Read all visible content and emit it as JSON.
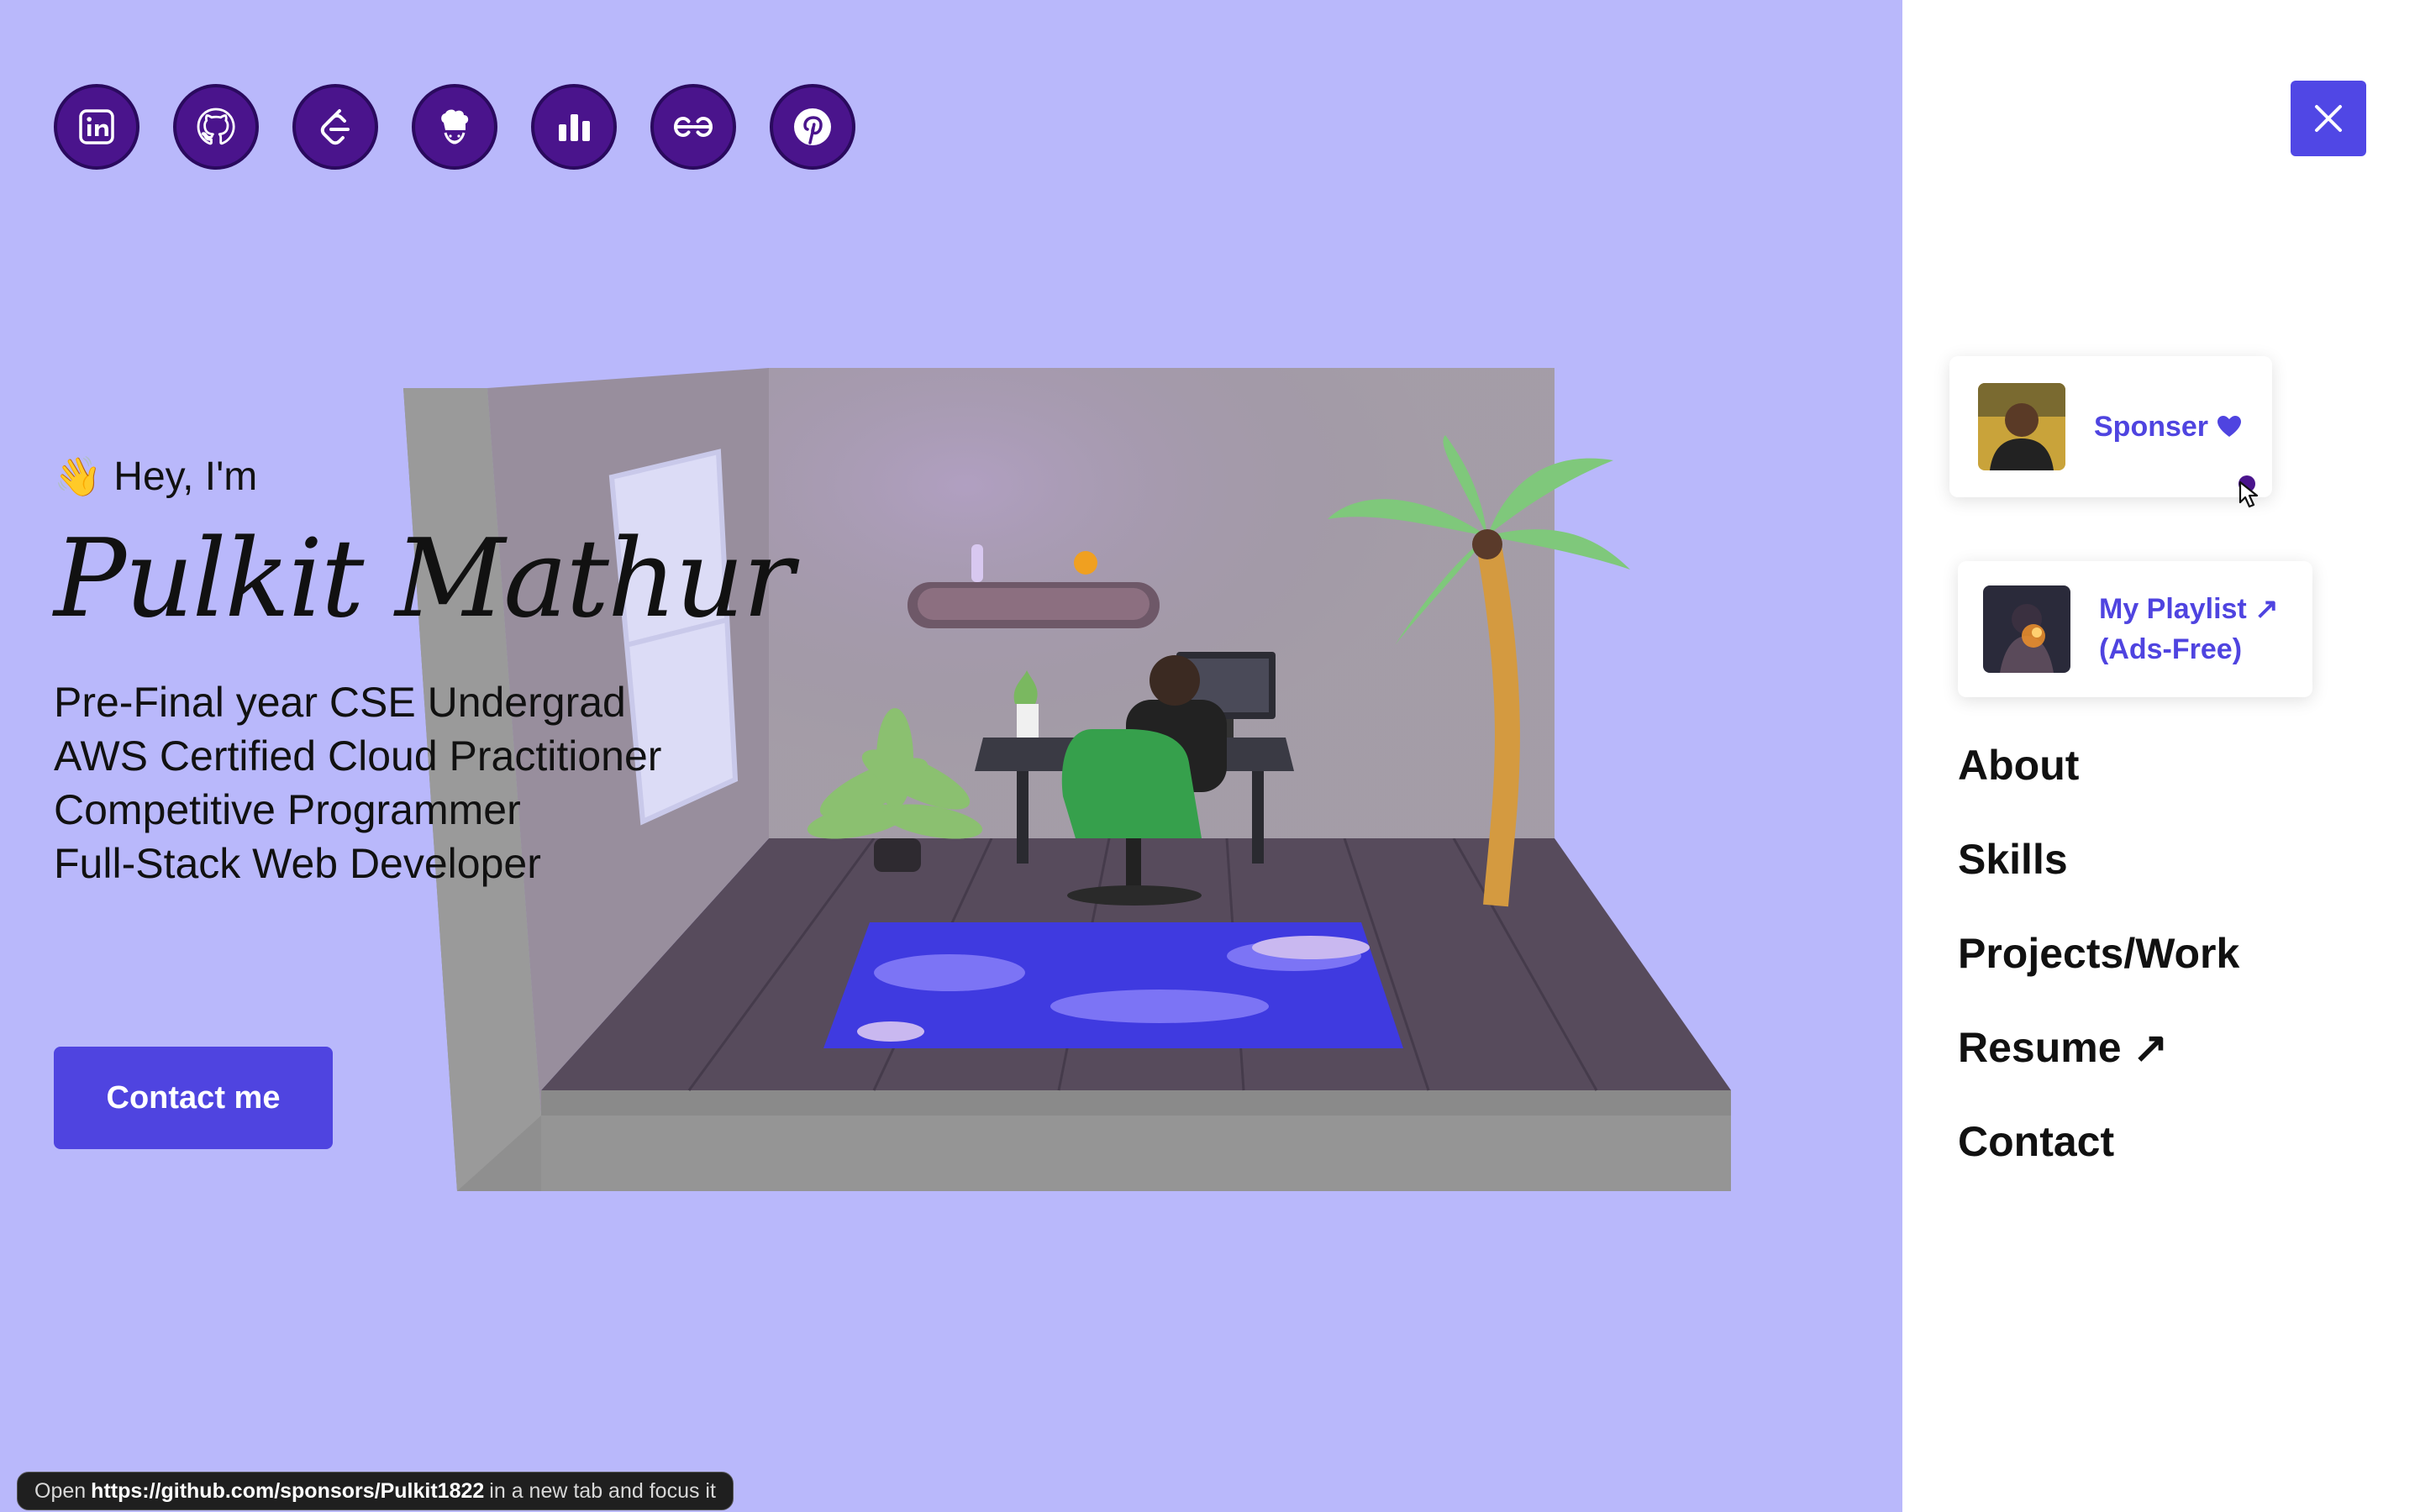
{
  "social_links": [
    {
      "name": "linkedin-icon"
    },
    {
      "name": "github-icon"
    },
    {
      "name": "leetcode-icon"
    },
    {
      "name": "codechef-icon"
    },
    {
      "name": "codeforces-icon"
    },
    {
      "name": "geeksforgeeks-icon"
    },
    {
      "name": "pinterest-icon"
    }
  ],
  "hero": {
    "wave": "👋",
    "greeting": "Hey, I'm",
    "name": "Pulkit Mathur",
    "roles": [
      "Pre-Final year CSE Undergrad",
      "AWS Certified Cloud Practitioner",
      "Competitive Programmer",
      "Full-Stack Web Developer"
    ],
    "contact_label": "Contact me"
  },
  "panel": {
    "sponsor_label": "Sponser",
    "playlist_line1": "My Playlist ↗",
    "playlist_line2": "(Ads-Free)",
    "nav": [
      "About",
      "Skills",
      "Projects/Work",
      "Resume ↗",
      "Contact"
    ]
  },
  "status_bar": {
    "prefix": "Open",
    "url": "https://github.com/sponsors/Pulkit1822",
    "suffix": "in a new tab and focus it"
  },
  "colors": {
    "background": "#b9b8fb",
    "accent": "#4f44e0",
    "icon_bg": "#4a148c"
  }
}
